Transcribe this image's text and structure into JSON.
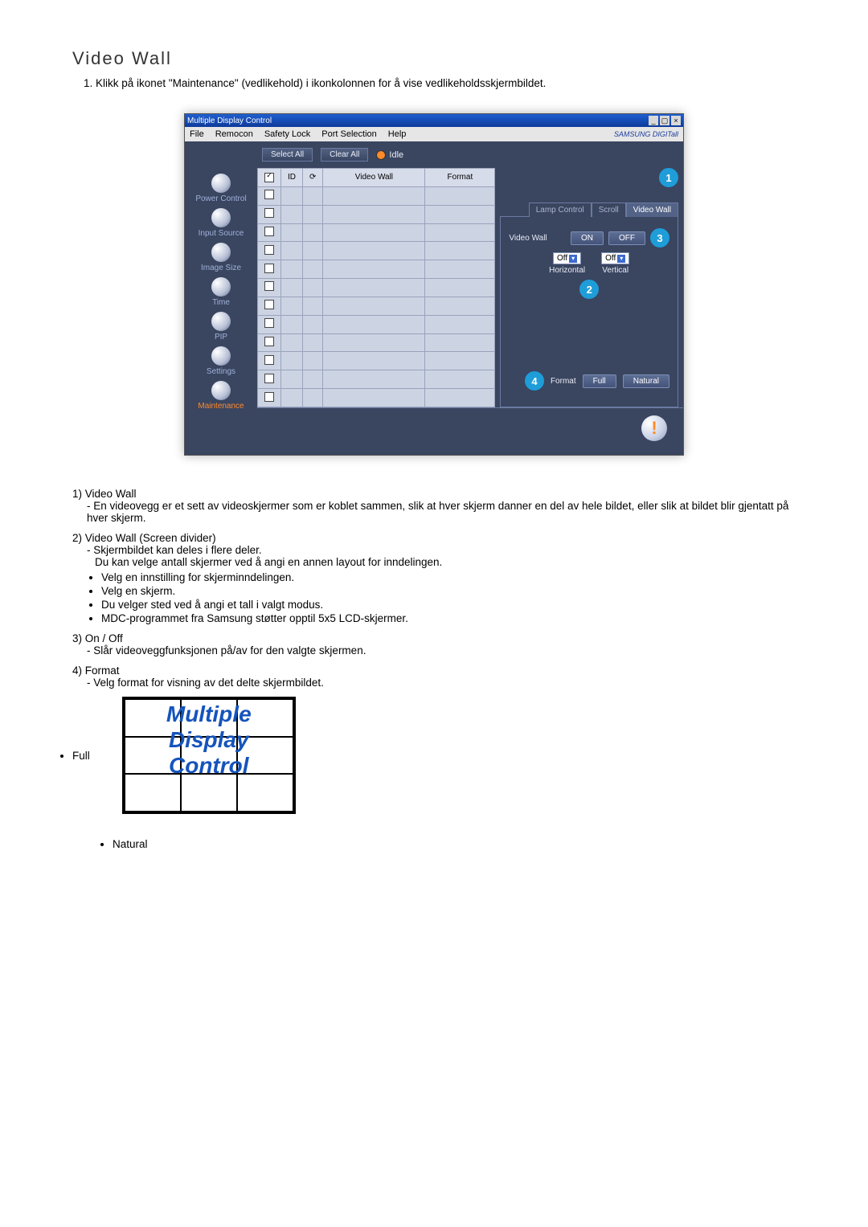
{
  "page": {
    "title": "Video Wall",
    "intro_num": "1.",
    "intro": "Klikk på ikonet \"Maintenance\" (vedlikehold) i ikonkolonnen for å vise vedlikeholdsskjermbildet."
  },
  "app": {
    "window_title": "Multiple Display Control",
    "brand": "SAMSUNG DIGITall",
    "menu": [
      "File",
      "Remocon",
      "Safety Lock",
      "Port Selection",
      "Help"
    ],
    "sidebar": [
      {
        "label": "Power Control"
      },
      {
        "label": "Input Source"
      },
      {
        "label": "Image Size"
      },
      {
        "label": "Time"
      },
      {
        "label": "PIP"
      },
      {
        "label": "Settings"
      },
      {
        "label": "Maintenance",
        "active": true
      }
    ],
    "toolbar": {
      "select_all": "Select All",
      "clear_all": "Clear All",
      "idle": "Idle"
    },
    "grid_headers": {
      "chk": " ",
      "id": "ID",
      "icon": " ",
      "video_wall": "Video Wall",
      "format": "Format"
    },
    "tabs": [
      "Lamp Control",
      "Scroll",
      "Video Wall"
    ],
    "panel": {
      "video_wall_label": "Video Wall",
      "on": "ON",
      "off": "OFF",
      "horiz_label": "Horizontal",
      "vert_label": "Vertical",
      "horiz_val": "Off",
      "vert_val": "Off",
      "format_label": "Format",
      "full": "Full",
      "natural": "Natural"
    },
    "callouts": {
      "c1": "1",
      "c2": "2",
      "c3": "3",
      "c4": "4"
    }
  },
  "desc": {
    "i1_title": "1)  Video Wall",
    "i1_body": "- En videovegg er et sett av videoskjermer som er koblet sammen, slik at hver skjerm danner en del av hele bildet, eller slik at bildet blir gjentatt på hver skjerm.",
    "i2_title": "2)  Video Wall (Screen divider)",
    "i2_l1": "- Skjermbildet kan deles i flere deler.",
    "i2_l2": "Du kan velge antall skjermer ved å angi en annen layout for inndelingen.",
    "i2_b": [
      "Velg en innstilling for skjerminndelingen.",
      "Velg en skjerm.",
      "Du velger sted ved å angi et tall i valgt modus.",
      "MDC-programmet fra Samsung støtter opptil 5x5 LCD-skjermer."
    ],
    "i3_title": "3)  On / Off",
    "i3_body": "- Slår videoveggfunksjonen på/av for den valgte skjermen.",
    "i4_title": "4)  Format",
    "i4_body": "- Velg format for visning av det delte skjermbildet.",
    "full_label": "Full",
    "natural_label": "Natural",
    "example_lines": [
      "Multiple",
      "Display",
      "Control"
    ]
  }
}
